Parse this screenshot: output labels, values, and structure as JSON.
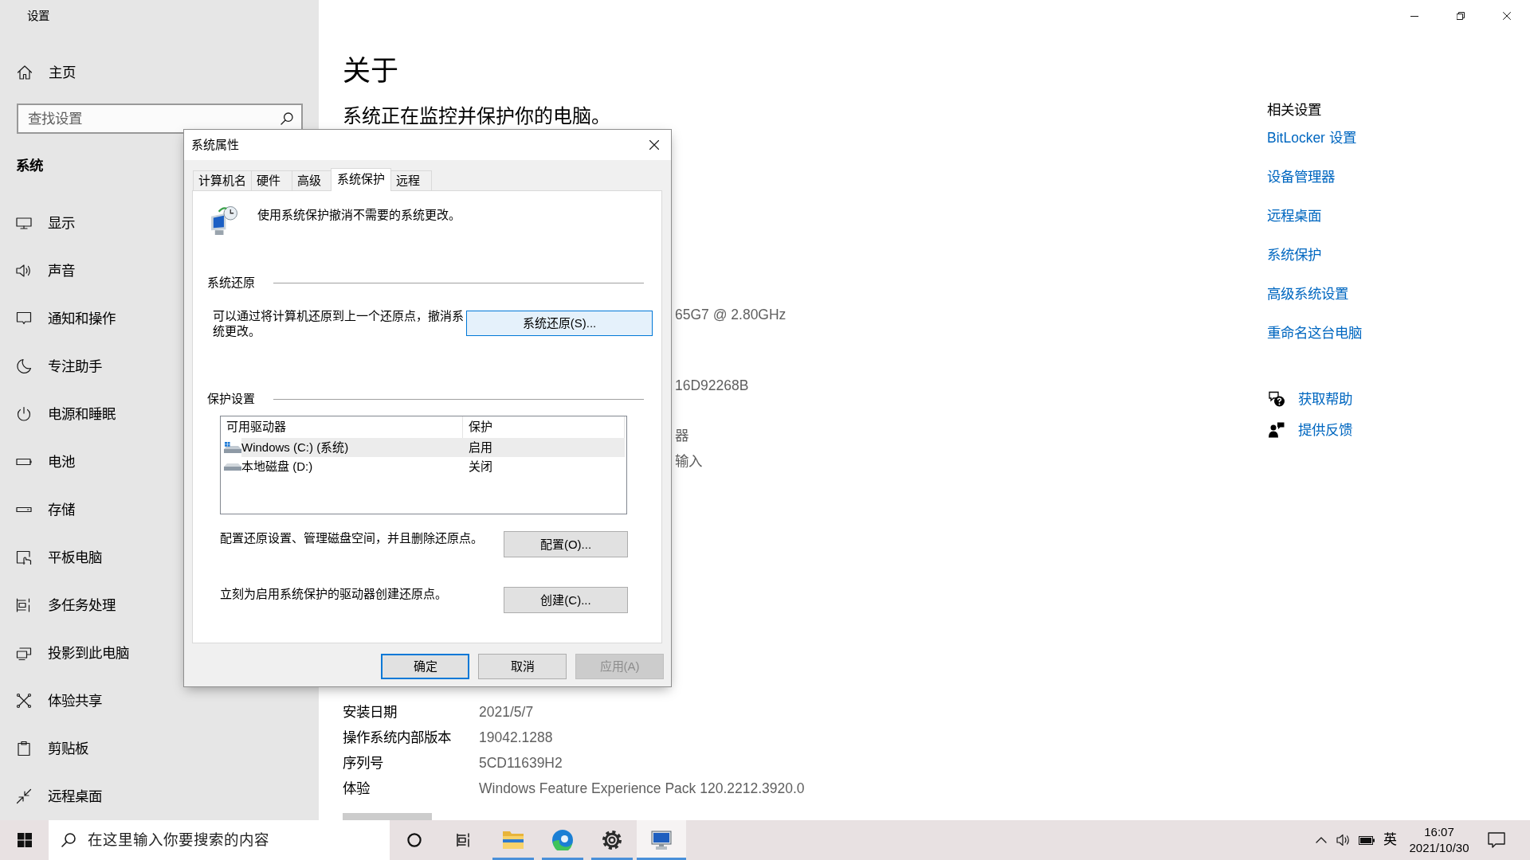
{
  "window": {
    "title": "设置"
  },
  "sidebar": {
    "home": "主页",
    "search": {
      "placeholder": "查找设置"
    },
    "section": "系统",
    "items": [
      {
        "kind": "display",
        "label": "显示"
      },
      {
        "kind": "sound",
        "label": "声音"
      },
      {
        "kind": "notifications",
        "label": "通知和操作"
      },
      {
        "kind": "focus",
        "label": "专注助手"
      },
      {
        "kind": "power",
        "label": "电源和睡眠"
      },
      {
        "kind": "battery",
        "label": "电池"
      },
      {
        "kind": "storage",
        "label": "存储"
      },
      {
        "kind": "tablet",
        "label": "平板电脑"
      },
      {
        "kind": "multitasking",
        "label": "多任务处理"
      },
      {
        "kind": "projecting",
        "label": "投影到此电脑"
      },
      {
        "kind": "shared",
        "label": "体验共享"
      },
      {
        "kind": "clipboard",
        "label": "剪贴板"
      },
      {
        "kind": "remote",
        "label": "远程桌面"
      }
    ]
  },
  "about": {
    "title": "关于",
    "status": "系统正在监控并保护你的电脑。",
    "partly_hidden_values": [
      "65G7 @ 2.80GHz",
      "16D92268B",
      "器",
      "输入"
    ],
    "specs": [
      {
        "label": "安装日期",
        "value": "2021/5/7"
      },
      {
        "label": "操作系统内部版本",
        "value": "19042.1288"
      },
      {
        "label": "序列号",
        "value": "5CD11639H2"
      },
      {
        "label": "体验",
        "value": "Windows Feature Experience Pack 120.2212.3920.0"
      }
    ]
  },
  "related": {
    "heading": "相关设置",
    "links": [
      "BitLocker 设置",
      "设备管理器",
      "远程桌面",
      "系统保护",
      "高级系统设置",
      "重命名这台电脑"
    ],
    "help": [
      {
        "kind": "help",
        "label": "获取帮助"
      },
      {
        "kind": "feedback",
        "label": "提供反馈"
      }
    ]
  },
  "dialog": {
    "title": "系统属性",
    "tabs": [
      {
        "label": "计算机名",
        "selected": false
      },
      {
        "label": "硬件",
        "selected": false
      },
      {
        "label": "高级",
        "selected": false
      },
      {
        "label": "系统保护",
        "selected": true
      },
      {
        "label": "远程",
        "selected": false
      }
    ],
    "intro": "使用系统保护撤消不需要的系统更改。",
    "system_restore": {
      "heading": "系统还原",
      "description": "可以通过将计算机还原到上一个还原点，撤消系统更改。",
      "button": {
        "label": "系统还原(S)...",
        "hovered": true
      }
    },
    "protection": {
      "heading": "保护设置",
      "columns": [
        "可用驱动器",
        "保护"
      ],
      "drives": [
        {
          "kind": "system",
          "name": "Windows (C:) (系统)",
          "protection": "启用",
          "selected": true
        },
        {
          "kind": "local",
          "name": "本地磁盘 (D:)",
          "protection": "关闭",
          "selected": false
        }
      ],
      "actions": [
        {
          "description": "配置还原设置、管理磁盘空间，并且删除还原点。",
          "button": {
            "label": "配置(O)...",
            "hovered": false
          }
        },
        {
          "description": "立刻为启用系统保护的驱动器创建还原点。",
          "button": {
            "label": "创建(C)...",
            "hovered": false
          }
        }
      ]
    },
    "buttons": [
      {
        "label": "确定",
        "default": true,
        "disabled": false
      },
      {
        "label": "取消",
        "default": false,
        "disabled": false
      },
      {
        "label": "应用(A)",
        "default": false,
        "disabled": true
      }
    ]
  },
  "taskbar": {
    "search": {
      "placeholder": "在这里输入你要搜索的内容"
    },
    "apps": [
      {
        "kind": "assistant",
        "running": false,
        "active": false
      },
      {
        "kind": "taskview",
        "running": false,
        "active": false
      },
      {
        "kind": "explorer",
        "running": true,
        "active": false
      },
      {
        "kind": "browser",
        "running": true,
        "active": false
      },
      {
        "kind": "settings",
        "running": true,
        "active": false
      },
      {
        "kind": "properties",
        "running": true,
        "active": true
      }
    ],
    "input_method": "英",
    "time": "16:07",
    "date": "2021/10/30"
  }
}
